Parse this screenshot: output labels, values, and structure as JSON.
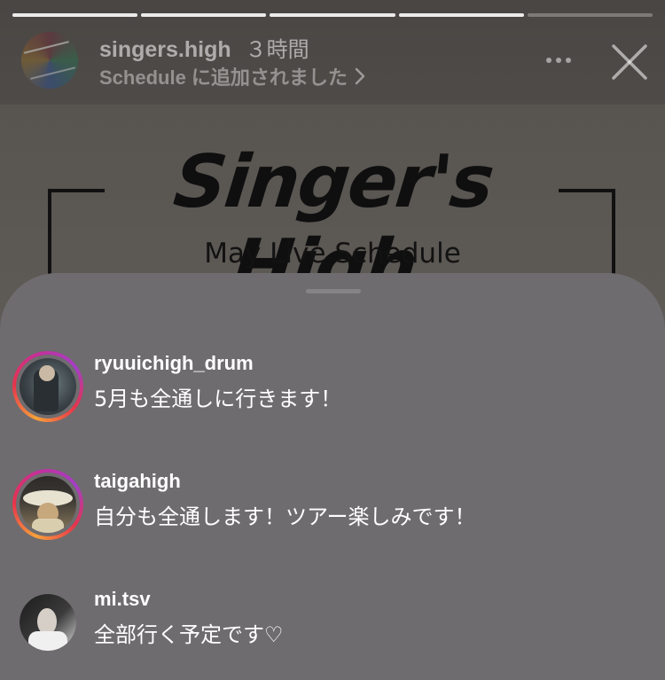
{
  "story": {
    "username": "singers.high",
    "time": "３時間",
    "subtitle": "Schedule に追加されました",
    "progress": [
      1,
      1,
      1,
      1,
      0
    ],
    "poster": {
      "logo_text": "Singer's High",
      "subtitle": "May Live Schedule"
    },
    "icons": {
      "more": "more-horizontal-icon",
      "close": "close-icon",
      "chevron": "chevron-right-icon"
    }
  },
  "replies": [
    {
      "username": "ryuuichigh_drum",
      "message": "5月も全通しに行きます！",
      "ring": true
    },
    {
      "username": "taigahigh",
      "message": "自分も全通します！ツアー楽しみです！",
      "ring": true
    },
    {
      "username": "mi.tsv",
      "message": "全部行く予定です♡",
      "ring": false
    }
  ],
  "colors": {
    "sheet": "#6f6c6f",
    "story_ring_gradient": [
      "#f7a23a",
      "#e8334a",
      "#c42f9c"
    ]
  }
}
